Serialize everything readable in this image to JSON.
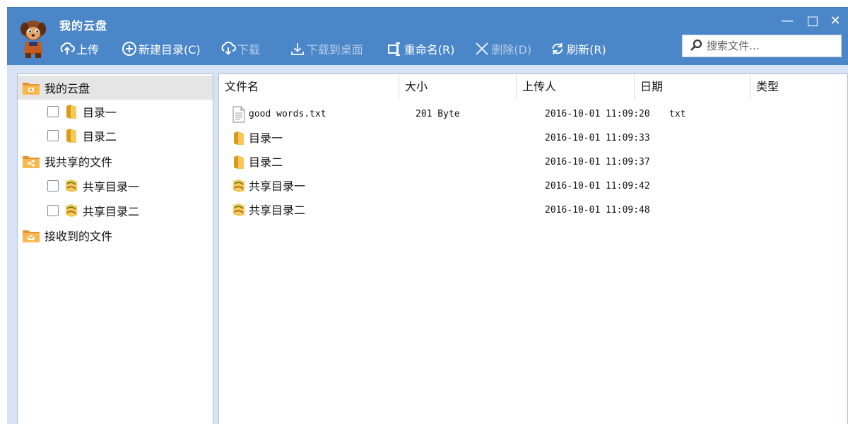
{
  "app": {
    "title": "我的云盘"
  },
  "window_controls": {
    "minimize": "—",
    "maximize": "□",
    "close": "✕"
  },
  "toolbar": {
    "upload": "上传",
    "new_folder": "新建目录(C)",
    "download": "下载",
    "download_to_desktop": "下载到桌面",
    "rename": "重命名(R)",
    "delete": "删除(D)",
    "refresh": "刷新(R)"
  },
  "search": {
    "placeholder": "搜索文件…"
  },
  "tree": {
    "my_disk": "我的云盘",
    "dir1": "目录一",
    "dir2": "目录二",
    "shared": "我共享的文件",
    "shared_dir1": "共享目录一",
    "shared_dir2": "共享目录二",
    "received": "接收到的文件"
  },
  "list": {
    "headers": {
      "name": "文件名",
      "size": "大小",
      "uploader": "上传人",
      "date": "日期",
      "type": "类型"
    },
    "rows": [
      {
        "name": "good words.txt",
        "size": "201 Byte",
        "date": "2016-10-01 11:09:20",
        "type": "txt",
        "icon": "text-file-icon"
      },
      {
        "name": "目录一",
        "size": "",
        "date": "2016-10-01 11:09:33",
        "type": "",
        "icon": "folder-icon"
      },
      {
        "name": "目录二",
        "size": "",
        "date": "2016-10-01 11:09:37",
        "type": "",
        "icon": "folder-icon"
      },
      {
        "name": "共享目录一",
        "size": "",
        "date": "2016-10-01 11:09:42",
        "type": "",
        "icon": "shared-folder-icon"
      },
      {
        "name": "共享目录二",
        "size": "",
        "date": "2016-10-01 11:09:48",
        "type": "",
        "icon": "shared-folder-icon"
      }
    ]
  },
  "colors": {
    "header_bg": "#4a86c8",
    "body_bg": "#d7e3f2",
    "selected_bg": "#e5e5e5",
    "disabled_text": "#b7cde9"
  }
}
